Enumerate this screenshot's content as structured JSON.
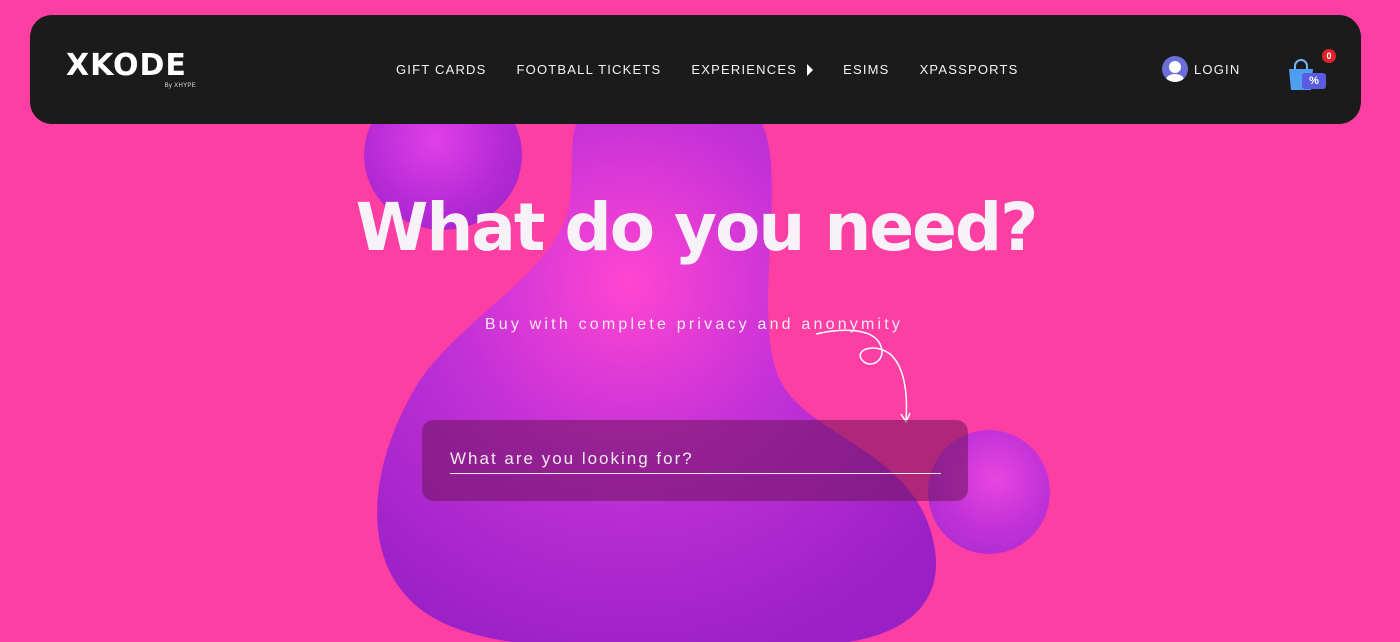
{
  "brand": {
    "name": "XKODE",
    "sub": "By XHYPE"
  },
  "nav": {
    "items": [
      {
        "label": "GIFT CARDS"
      },
      {
        "label": "FOOTBALL TICKETS"
      },
      {
        "label": "EXPERIENCES"
      },
      {
        "label": "ESIMS"
      },
      {
        "label": "XPASSPORTS"
      }
    ],
    "login_label": "LOGIN"
  },
  "cart": {
    "count": "0",
    "tag": "%"
  },
  "hero": {
    "title": "What do you need?",
    "subtitle": "Buy with complete privacy and anonymity"
  },
  "search": {
    "placeholder": "What are you looking for?"
  },
  "colors": {
    "background": "#fd3fa4",
    "navbar": "#1b1b1b",
    "blob": "#b02ad0",
    "badge": "#e0232a",
    "avatar": "#6d6fd8"
  }
}
